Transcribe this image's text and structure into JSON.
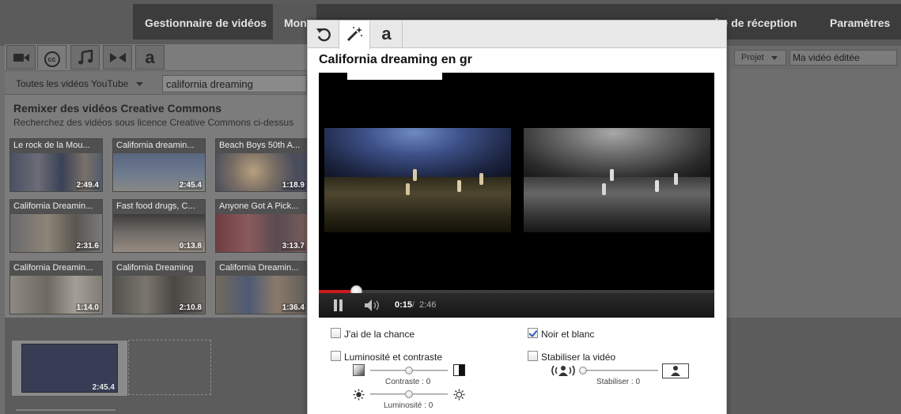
{
  "topnav": {
    "items": [
      {
        "label": "Gestionnaire de vidéos"
      },
      {
        "label": "Mon"
      },
      {
        "label": "îte de réception"
      },
      {
        "label": "Paramètres"
      }
    ]
  },
  "left_panel": {
    "tab_icons": [
      "video-camera-icon",
      "creative-commons-icon",
      "music-note-icon",
      "transition-icon",
      "text-icon"
    ],
    "cc_glyph": "cc",
    "text_glyph": "a",
    "source_dropdown": "Toutes les vidéos YouTube",
    "search_value": "california dreaming",
    "title": "Remixer des vidéos Creative Commons",
    "subtitle": "Recherchez des vidéos sous licence Creative Commons ci-dessus",
    "thumbnails": [
      {
        "title": "Le rock de la Mou...",
        "duration": "2:49.4"
      },
      {
        "title": "California dreamin...",
        "duration": "2:45.4"
      },
      {
        "title": "Beach Boys 50th A...",
        "duration": "1:18.9"
      },
      {
        "title": "California Dreamin...",
        "duration": "2:31.6"
      },
      {
        "title": "Fast food drugs, C...",
        "duration": "0:13.8"
      },
      {
        "title": "Anyone Got A Pick...",
        "duration": "3:13.7"
      },
      {
        "title": "California Dreamin...",
        "duration": "1:14.0"
      },
      {
        "title": "California Dreaming",
        "duration": "2:10.8"
      },
      {
        "title": "California Dreamin...",
        "duration": "1:36.4"
      }
    ]
  },
  "timeline": {
    "clip_duration": "2:45.4"
  },
  "project": {
    "button": "Projet",
    "name": "Ma vidéo éditée"
  },
  "dialog": {
    "tab_icons": [
      "undo-icon",
      "magic-wand-icon",
      "text-icon"
    ],
    "text_glyph": "a",
    "title": "California dreaming en gr",
    "player": {
      "current_time": "0:15",
      "separator": "/",
      "duration": "2:46",
      "progress_fraction": 0.095
    },
    "options": {
      "lucky": {
        "label": "J'ai de la chance",
        "checked": false
      },
      "bw": {
        "label": "Noir et blanc",
        "checked": true
      },
      "brightness": {
        "label": "Luminosité et contraste",
        "checked": false
      },
      "stabilize": {
        "label": "Stabiliser la vidéo",
        "checked": false
      }
    },
    "sliders": {
      "contrast": {
        "caption": "Contraste : 0",
        "value": 0
      },
      "brightness": {
        "caption": "Luminosité : 0",
        "value": 0
      },
      "stabilize": {
        "caption": "Stabiliser : 0",
        "value": 0
      }
    }
  }
}
